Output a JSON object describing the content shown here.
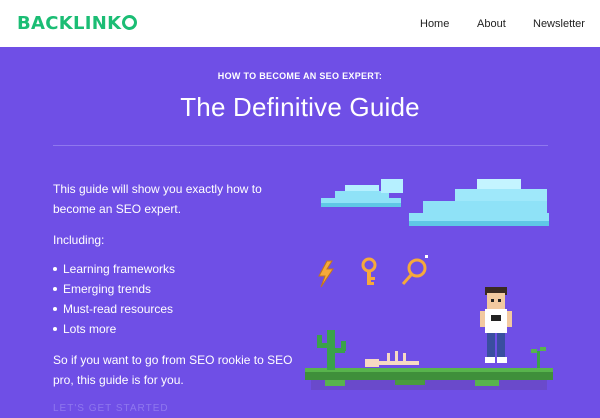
{
  "header": {
    "logo": "BACKLINK",
    "nav": [
      "Home",
      "About",
      "Newsletter"
    ]
  },
  "hero": {
    "kicker": "HOW TO BECOME AN SEO EXPERT:",
    "title": "The Definitive Guide"
  },
  "body": {
    "intro": "This guide will show you exactly how to become an SEO expert.",
    "including": "Including:",
    "bullets": [
      "Learning frameworks",
      "Emerging trends",
      "Must-read resources",
      "Lots more"
    ],
    "closing": "So if you want to go from SEO rookie to SEO pro, this guide is for you.",
    "cta": "LET'S GET STARTED"
  },
  "colors": {
    "brand": "#1bbd74",
    "background": "#6f4fe6",
    "accent": "#f6a93b"
  },
  "icons": [
    "lightning-icon",
    "key-icon",
    "magnifier-icon"
  ]
}
